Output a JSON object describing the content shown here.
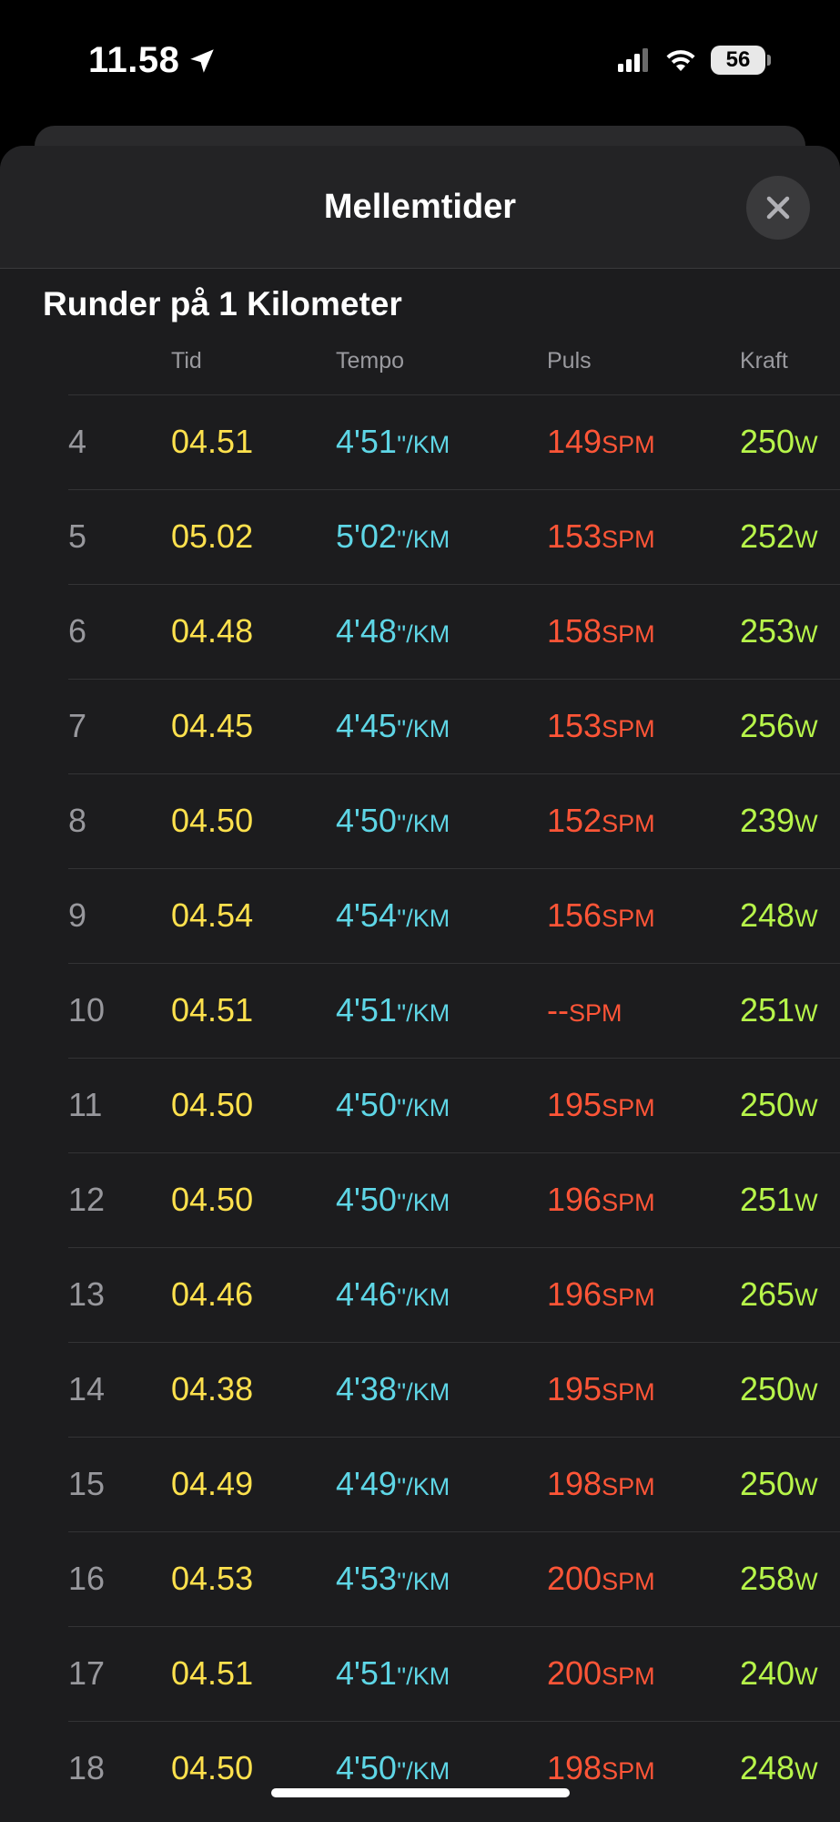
{
  "status_bar": {
    "time": "11.58",
    "battery": "56"
  },
  "sheet": {
    "title": "Mellemtider",
    "section_title": "Runder på 1 Kilometer",
    "columns": {
      "tid": "Tid",
      "tempo": "Tempo",
      "puls": "Puls",
      "kraft": "Kraft"
    },
    "units": {
      "tempo": "''/KM",
      "puls": "SPM",
      "kraft": "W"
    },
    "rows": [
      {
        "num": "4",
        "tid": "04.51",
        "tempo": "4'51",
        "puls": "149",
        "kraft": "250"
      },
      {
        "num": "5",
        "tid": "05.02",
        "tempo": "5'02",
        "puls": "153",
        "kraft": "252"
      },
      {
        "num": "6",
        "tid": "04.48",
        "tempo": "4'48",
        "puls": "158",
        "kraft": "253"
      },
      {
        "num": "7",
        "tid": "04.45",
        "tempo": "4'45",
        "puls": "153",
        "kraft": "256"
      },
      {
        "num": "8",
        "tid": "04.50",
        "tempo": "4'50",
        "puls": "152",
        "kraft": "239"
      },
      {
        "num": "9",
        "tid": "04.54",
        "tempo": "4'54",
        "puls": "156",
        "kraft": "248"
      },
      {
        "num": "10",
        "tid": "04.51",
        "tempo": "4'51",
        "puls": "--",
        "kraft": "251"
      },
      {
        "num": "11",
        "tid": "04.50",
        "tempo": "4'50",
        "puls": "195",
        "kraft": "250"
      },
      {
        "num": "12",
        "tid": "04.50",
        "tempo": "4'50",
        "puls": "196",
        "kraft": "251"
      },
      {
        "num": "13",
        "tid": "04.46",
        "tempo": "4'46",
        "puls": "196",
        "kraft": "265"
      },
      {
        "num": "14",
        "tid": "04.38",
        "tempo": "4'38",
        "puls": "195",
        "kraft": "250"
      },
      {
        "num": "15",
        "tid": "04.49",
        "tempo": "4'49",
        "puls": "198",
        "kraft": "250"
      },
      {
        "num": "16",
        "tid": "04.53",
        "tempo": "4'53",
        "puls": "200",
        "kraft": "258"
      },
      {
        "num": "17",
        "tid": "04.51",
        "tempo": "4'51",
        "puls": "200",
        "kraft": "240"
      },
      {
        "num": "18",
        "tid": "04.50",
        "tempo": "4'50",
        "puls": "198",
        "kraft": "248"
      }
    ]
  },
  "icons": {
    "location": "location-arrow-icon",
    "signal": "cellular-signal-icon",
    "wifi": "wifi-icon",
    "battery": "battery-icon",
    "close": "close-icon"
  },
  "colors": {
    "tid": "#ffe14d",
    "tempo": "#5ed6e6",
    "puls": "#ff5537",
    "kraft": "#b7f54a"
  }
}
